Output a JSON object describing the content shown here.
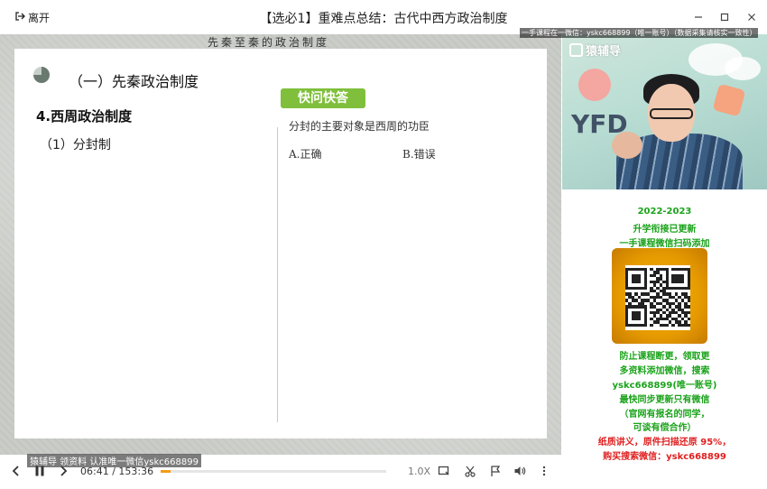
{
  "window": {
    "leave_label": "离开",
    "title": "【选必1】重难点总结：古代中西方政治制度",
    "controls": [
      "minimize-icon",
      "maximize-icon",
      "close-icon"
    ]
  },
  "slide": {
    "banner": "先秦至秦的政治制度",
    "section_title": "（一）先秦政治制度",
    "subsection": "4.西周政治制度",
    "point": "（1）分封制",
    "quiz_tag": "快问快答",
    "question": "分封的主要对象是西周的功臣",
    "option_a": "A.正确",
    "option_b": "B.错误",
    "tag_color": "#7fbf3c"
  },
  "video": {
    "logo_text": "猿辅导",
    "overlay_text": "YFD",
    "watermark_top": "一手课程在一微信：yskc668899（唯一账号）（数据采集请核实一致性）"
  },
  "sidebar_ad": {
    "line1": "2022-2023",
    "line2": "升学衔接已更新",
    "line3": "一手课程微信扫码添加",
    "line4": "防止课程断更，领取更",
    "line5": "多资料添加微信，搜索",
    "line6": "yskc668899(唯一账号)",
    "line7": "最快同步更新只有微信",
    "line8": "（官网有报名的同学，",
    "line9": "可谈有偿合作）",
    "line10": "纸质讲义，原件扫描还原 95%，",
    "line11": "购买搜索微信：yskc668899",
    "green_color": "#1aa31a",
    "red_color": "#e02020"
  },
  "player": {
    "watermark_bottom": "猿辅导 领资料 认准唯一微信yskc668899",
    "current_time": "06:41",
    "separator": "/",
    "total_time": "153:36",
    "progress": 0.0435,
    "speed": "1.0X",
    "progress_color": "#f39c12"
  }
}
